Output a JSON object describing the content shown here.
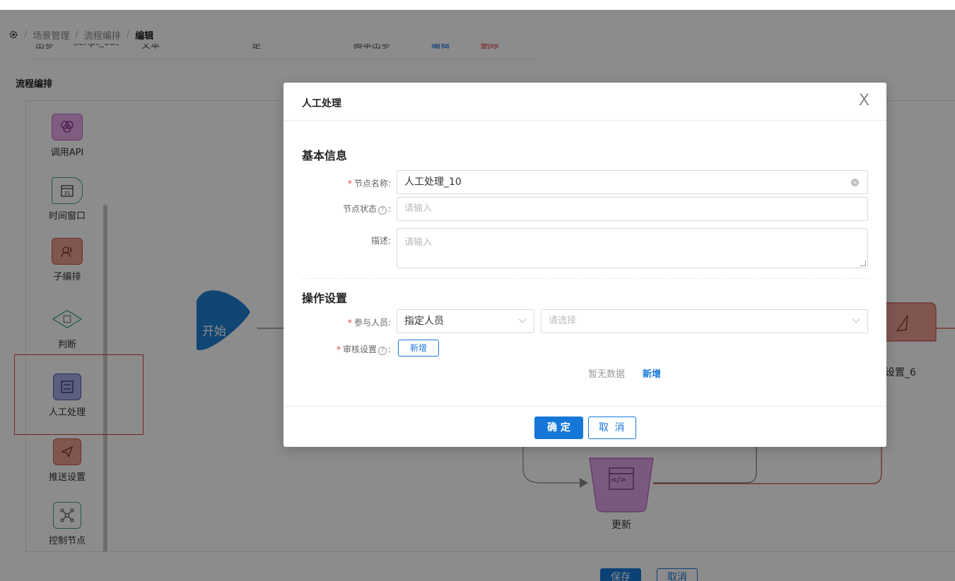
{
  "breadcrumb": {
    "items": [
      "场景管理",
      "流程编排",
      "编辑"
    ]
  },
  "cut_row": [
    "出参",
    "script_out",
    "文本",
    "是",
    "脚本出参",
    "编辑",
    "删除"
  ],
  "section_title": "流程编排",
  "palette": {
    "items": [
      {
        "label": "调用API",
        "icon": "api-icon",
        "color": "#d07ad4"
      },
      {
        "label": "时间窗口",
        "icon": "calendar-icon",
        "color": "#4fb6a8"
      },
      {
        "label": "子编排",
        "icon": "sub-flow-icon",
        "color": "#e06a5e"
      },
      {
        "label": "判断",
        "icon": "diamond-icon",
        "color": "#4fb6a8"
      },
      {
        "label": "人工处理",
        "icon": "manual-icon",
        "color": "#6b78d4"
      },
      {
        "label": "推送设置",
        "icon": "send-icon",
        "color": "#e06a5e"
      },
      {
        "label": "控制节点",
        "icon": "network-icon",
        "color": "#4fb6a8"
      }
    ],
    "calendar_day": "31"
  },
  "canvas": {
    "start_label": "开始",
    "push_node_label": "设置_6",
    "update_node_label": "更新",
    "update_icon_text": "</>"
  },
  "bottom": {
    "save_label": "保存",
    "cancel_label": "取消"
  },
  "modal": {
    "title": "人工处理",
    "close_glyph": "X",
    "basic_info_title": "基本信息",
    "node_name_label": "节点名称:",
    "node_name_value": "人工处理_10",
    "node_status_label": "节点状态",
    "node_status_placeholder": "请输入",
    "desc_label": "描述:",
    "desc_placeholder": "请输入",
    "ops_title": "操作设置",
    "participants_label": "参与人员:",
    "participants_value": "指定人员",
    "participants_select_placeholder": "请选择",
    "review_label": "审核设置",
    "review_add_label": "新增",
    "empty_text": "暂无数据",
    "empty_add_label": "新增",
    "help_glyph": "?",
    "colon": ":",
    "ok_label": "确 定",
    "cancel_label": "取 消"
  },
  "colors": {
    "primary": "#1677d8",
    "required": "#e43b3b",
    "highlight_box": "#e43b3b"
  }
}
